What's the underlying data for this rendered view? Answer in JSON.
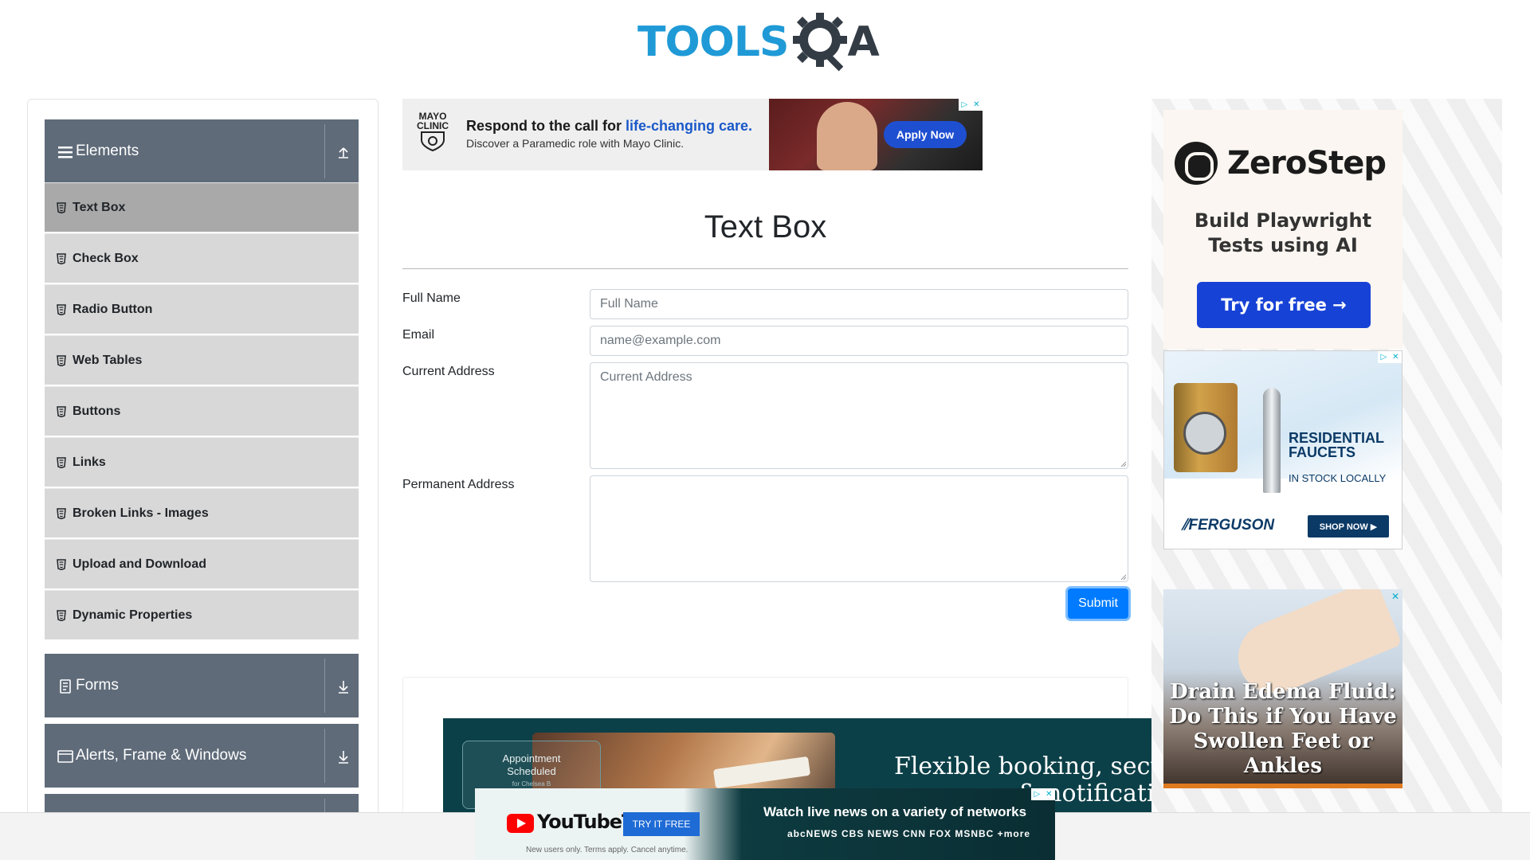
{
  "header": {
    "logo_part1": "TOOLS",
    "logo_part2": "A",
    "logo_icon": "gear-magnifier-icon"
  },
  "sidebar": {
    "groups": [
      {
        "label": "Elements",
        "icon": "hamburger-icon",
        "expanded": true
      },
      {
        "label": "Forms",
        "icon": "document-icon",
        "expanded": false
      },
      {
        "label": "Alerts, Frame & Windows",
        "icon": "window-icon",
        "expanded": false
      }
    ],
    "items": [
      {
        "label": "Text Box",
        "active": true
      },
      {
        "label": "Check Box"
      },
      {
        "label": "Radio Button"
      },
      {
        "label": "Web Tables"
      },
      {
        "label": "Buttons"
      },
      {
        "label": "Links"
      },
      {
        "label": "Broken Links - Images"
      },
      {
        "label": "Upload and Download"
      },
      {
        "label": "Dynamic Properties"
      }
    ]
  },
  "ads": {
    "mayo": {
      "logo_line1": "MAYO",
      "logo_line2": "CLINIC",
      "headline": "Respond to the call for ",
      "headline_highlight": "life-changing care.",
      "sub": "Discover a Paramedic role with Mayo Clinic.",
      "cta": "Apply Now"
    },
    "zerostep": {
      "brand": "ZeroStep",
      "line1": "Build Playwright",
      "line2": "Tests using AI",
      "cta": "Try for free →"
    },
    "ferguson": {
      "headline1": "RESIDENTIAL",
      "headline2": "FAUCETS",
      "sub": "IN STOCK LOCALLY",
      "brand": "⫽FERGUSON",
      "cta": "SHOP NOW ▶"
    },
    "edema": {
      "line1": "Drain Edema Fluid:",
      "line2": "Do This if You Have",
      "line3": "Swollen Feet or",
      "line4": "Ankles"
    },
    "appointment": {
      "card_line1": "Appointment",
      "card_line2": "Scheduled",
      "card_small": "for Chelsea B",
      "headline1": "Flexible booking, secure",
      "headline2": "s & notification"
    },
    "youtube_tv": {
      "brand": "YouTubeTV",
      "cta": "TRY IT FREE",
      "headline": "Watch live news on a variety of networks",
      "networks": "abcNEWS  CBS NEWS  CNN  FOX  MSNBC  +more",
      "fine_print": "New users only. Terms apply. Cancel anytime."
    }
  },
  "main": {
    "title": "Text Box",
    "fields": {
      "full_name_label": "Full Name",
      "full_name_placeholder": "Full Name",
      "email_label": "Email",
      "email_placeholder": "name@example.com",
      "current_address_label": "Current Address",
      "current_address_placeholder": "Current Address",
      "permanent_address_label": "Permanent Address"
    },
    "submit_label": "Submit"
  },
  "colors": {
    "brand_blue": "#1f9ad6",
    "sidebar_header": "#5f6b79",
    "sidebar_item": "#d8d8d8",
    "sidebar_item_active": "#a9a9a9",
    "primary": "#007bff"
  }
}
